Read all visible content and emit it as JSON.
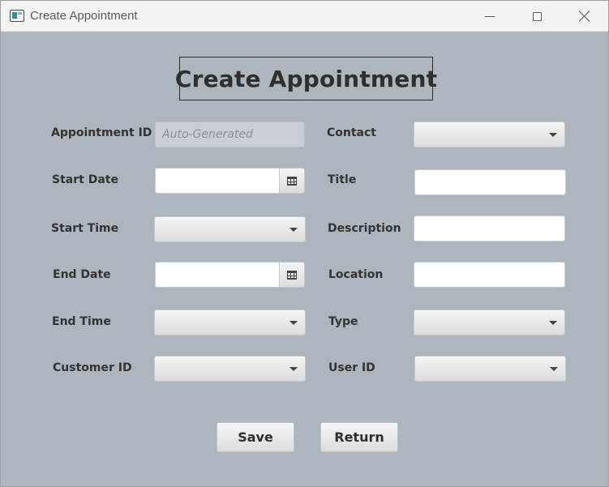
{
  "window": {
    "title": "Create Appointment",
    "icon": "app-window-icon"
  },
  "heading": "Create Appointment",
  "labels": {
    "appointment_id": "Appointment ID",
    "start_date": "Start Date",
    "start_time": "Start Time",
    "end_date": "End Date",
    "end_time": "End Time",
    "customer_id": "Customer ID",
    "contact": "Contact",
    "title": "Title",
    "description": "Description",
    "location": "Location",
    "type": "Type",
    "user_id": "User ID"
  },
  "fields": {
    "appointment_id": {
      "value": "",
      "placeholder": "Auto-Generated",
      "disabled": true
    },
    "title": {
      "value": ""
    },
    "description": {
      "value": ""
    },
    "location": {
      "value": ""
    },
    "start_date": {
      "value": ""
    },
    "end_date": {
      "value": ""
    }
  },
  "combos": {
    "contact": "",
    "start_time": "",
    "end_time": "",
    "customer_id": "",
    "type": "",
    "user_id": ""
  },
  "buttons": {
    "save": "Save",
    "return": "Return"
  },
  "icons": {
    "datepicker": "calendar-icon",
    "combo": "chevron-down-icon",
    "minimize": "minimize-icon",
    "maximize": "maximize-icon",
    "close": "close-icon"
  },
  "colors": {
    "background": "#adb5bd",
    "titlebar": "#f3f3f3",
    "disabled_field": "#c9ced5"
  }
}
